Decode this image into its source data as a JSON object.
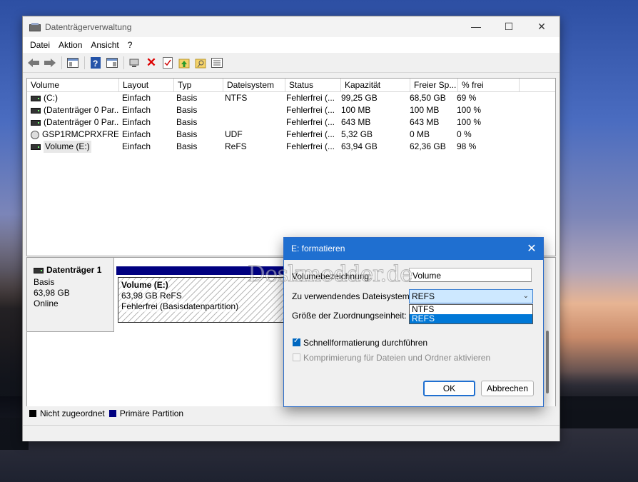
{
  "window": {
    "title": "Datenträgerverwaltung",
    "controls": {
      "minimize": "—",
      "maximize": "☐",
      "close": "✕"
    }
  },
  "menu": [
    "Datei",
    "Aktion",
    "Ansicht",
    "?"
  ],
  "toolbar": [
    "back-arrow-icon",
    "forward-arrow-icon",
    "console-tree-icon",
    "help-icon",
    "properties-icon",
    "connect-icon",
    "delete-icon",
    "checklist-icon",
    "folder-up-icon",
    "search-folder-icon",
    "view-list-icon"
  ],
  "volumes": {
    "headers": [
      "Volume",
      "Layout",
      "Typ",
      "Dateisystem",
      "Status",
      "Kapazität",
      "Freier Sp...",
      "% frei"
    ],
    "rows": [
      {
        "volume": "(C:)",
        "layout": "Einfach",
        "typ": "Basis",
        "fs": "NTFS",
        "status": "Fehlerfrei (...",
        "cap": "99,25 GB",
        "free": "68,50 GB",
        "pct": "69 %",
        "icon": "disk"
      },
      {
        "volume": "(Datenträger 0 Par...",
        "layout": "Einfach",
        "typ": "Basis",
        "fs": "",
        "status": "Fehlerfrei (...",
        "cap": "100 MB",
        "free": "100 MB",
        "pct": "100 %",
        "icon": "disk"
      },
      {
        "volume": "(Datenträger 0 Par...",
        "layout": "Einfach",
        "typ": "Basis",
        "fs": "",
        "status": "Fehlerfrei (...",
        "cap": "643 MB",
        "free": "643 MB",
        "pct": "100 %",
        "icon": "disk"
      },
      {
        "volume": "GSP1RMCPRXFRE...",
        "layout": "Einfach",
        "typ": "Basis",
        "fs": "UDF",
        "status": "Fehlerfrei (...",
        "cap": "5,32 GB",
        "free": "0 MB",
        "pct": "0 %",
        "icon": "cd"
      },
      {
        "volume": "Volume (E:)",
        "layout": "Einfach",
        "typ": "Basis",
        "fs": "ReFS",
        "status": "Fehlerfrei (...",
        "cap": "63,94 GB",
        "free": "62,36 GB",
        "pct": "98 %",
        "icon": "disk"
      }
    ]
  },
  "disk": {
    "name": "Datenträger 1",
    "type": "Basis",
    "size": "63,98 GB",
    "state": "Online"
  },
  "partition": {
    "name": "Volume  (E:)",
    "size": "63,98 GB ReFS",
    "status": "Fehlerfrei (Basisdatenpartition)"
  },
  "legend": {
    "unallocated": "Nicht zugeordnet",
    "primary": "Primäre Partition",
    "unallocated_color": "#000000",
    "primary_color": "#000080"
  },
  "dialog": {
    "title": "E: formatieren",
    "close": "✕",
    "label_name": "Volumebezeichnung:",
    "name_value": "Volume",
    "label_fs": "Zu verwendendes Dateisystem:",
    "fs_selected": "REFS",
    "fs_options": [
      "NTFS",
      "REFS"
    ],
    "label_alloc": "Größe der Zuordnungseinheit:",
    "quick_format": "Schnellformatierung durchführen",
    "compression": "Komprimierung für Dateien und Ordner aktivieren",
    "ok": "OK",
    "cancel": "Abbrechen"
  },
  "watermark": "Deskmodder.de"
}
